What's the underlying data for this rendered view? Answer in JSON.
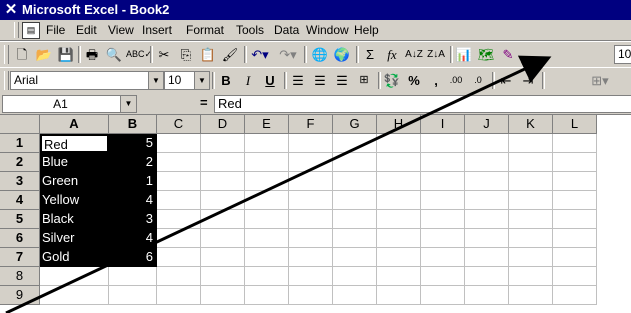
{
  "titlebar": {
    "title": "Microsoft Excel - Book2",
    "icon": "excel-logo-icon"
  },
  "menubar": {
    "items": [
      {
        "label": "File"
      },
      {
        "label": "Edit"
      },
      {
        "label": "View"
      },
      {
        "label": "Insert"
      },
      {
        "label": "Format"
      },
      {
        "label": "Tools"
      },
      {
        "label": "Data"
      },
      {
        "label": "Window"
      },
      {
        "label": "Help"
      }
    ]
  },
  "toolbar_standard": {
    "icons": [
      "new-icon",
      "open-icon",
      "save-icon",
      "print-icon",
      "print-preview-icon",
      "spelling-icon",
      "cut-icon",
      "copy-icon",
      "paste-icon",
      "format-painter-icon",
      "undo-icon",
      "redo-icon",
      "insert-hyperlink-icon",
      "web-toolbar-icon",
      "autosum-icon",
      "function-icon",
      "sort-ascending-icon",
      "sort-descending-icon",
      "chart-wizard-icon",
      "map-icon",
      "drawing-icon"
    ],
    "sum_glyph": "Σ",
    "fx_glyph": "fx",
    "zoom_partial": "10"
  },
  "toolbar_formatting": {
    "font": "Arial",
    "size": "10",
    "bold": "B",
    "italic": "I",
    "underline": "U",
    "percent": "%",
    "comma": ",",
    "inc_decimal": ".00",
    "dec_decimal": ".0"
  },
  "formula_bar": {
    "name_box": "A1",
    "equals": "=",
    "value": "Red"
  },
  "grid": {
    "columns": [
      "A",
      "B",
      "C",
      "D",
      "E",
      "F",
      "G",
      "H",
      "I",
      "J",
      "K",
      "L"
    ],
    "rows": [
      "1",
      "2",
      "3",
      "4",
      "5",
      "6",
      "7",
      "8",
      "9"
    ],
    "data": [
      {
        "name": "Red",
        "value": "5"
      },
      {
        "name": "Blue",
        "value": "2"
      },
      {
        "name": "Green",
        "value": "1"
      },
      {
        "name": "Yellow",
        "value": "4"
      },
      {
        "name": "Black",
        "value": "3"
      },
      {
        "name": "Silver",
        "value": "4"
      },
      {
        "name": "Gold",
        "value": "6"
      }
    ]
  },
  "colors": {
    "title_bar": "#000080",
    "chrome": "#d4d0c8",
    "selection": "#000000",
    "annotation_arrow": "#000000"
  }
}
